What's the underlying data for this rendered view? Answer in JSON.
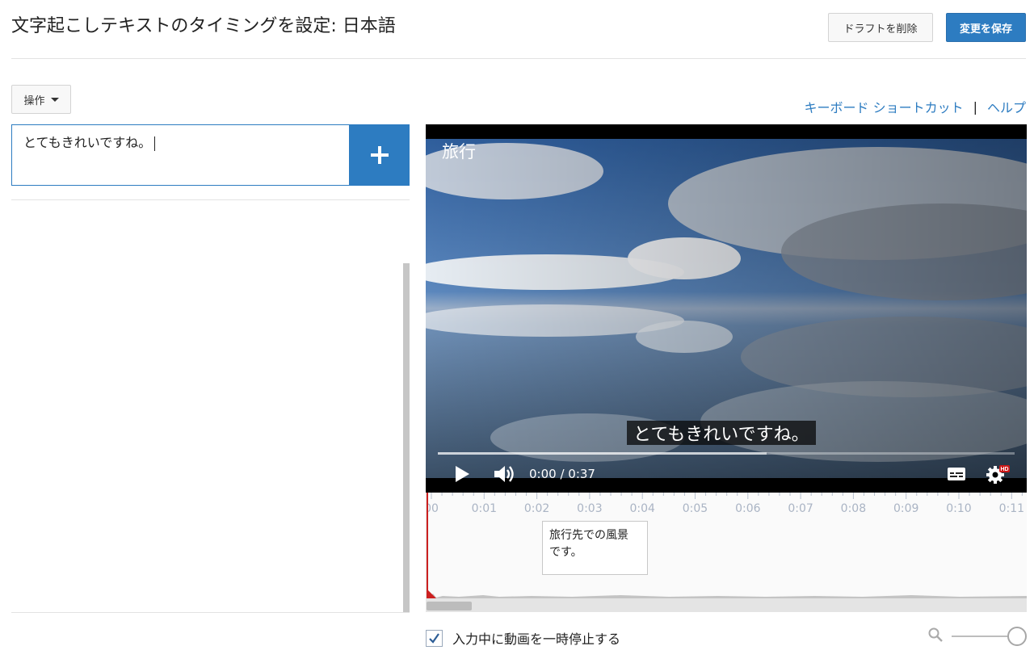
{
  "header": {
    "title": "文字起こしテキストのタイミングを設定: 日本語",
    "draft_delete": "ドラフトを削除",
    "save_changes": "変更を保存"
  },
  "toolbar": {
    "actions_label": "操作",
    "keyboard_shortcuts": "キーボード ショートカット",
    "separator": "|",
    "help": "ヘルプ"
  },
  "editor": {
    "caption_text": "とてもきれいですね。"
  },
  "video": {
    "title": "旅行",
    "subtitle": "とてもきれいですね。",
    "time": "0:00 / 0:37",
    "progress_loaded": 0.57,
    "hd_badge": "HD"
  },
  "timeline": {
    "ticks": [
      "00",
      "0:01",
      "0:02",
      "0:03",
      "0:04",
      "0:05",
      "0:06",
      "0:07",
      "0:08",
      "0:09",
      "0:10",
      "0:11"
    ],
    "cue_text_line1": "旅行先での風景",
    "cue_text_line2": "です。"
  },
  "footer": {
    "pause_while_typing": "入力中に動画を一時停止する",
    "pause_while_typing_checked": true,
    "zoom_level": 1.0
  },
  "colors": {
    "accent": "#2d7cc1",
    "playhead": "#cc2020"
  }
}
